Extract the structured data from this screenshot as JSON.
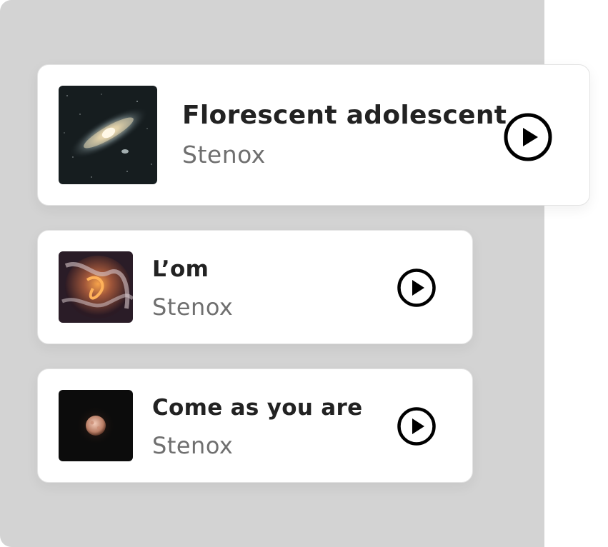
{
  "tracks": [
    {
      "title": "Florescent adolescent",
      "artist": "Stenox",
      "art": "galaxy-artwork",
      "state": "featured"
    },
    {
      "title": "L’om",
      "artist": "Stenox",
      "art": "abstract-flame-artwork"
    },
    {
      "title": "Come as you are",
      "artist": "Stenox",
      "art": "moon-artwork"
    }
  ],
  "icons": {
    "play": "play-circle-icon"
  },
  "colors": {
    "panel_bg": "#d3d3d3",
    "card_bg": "#ffffff",
    "title_text": "#222222",
    "artist_text": "#6f6f6f",
    "icon": "#000000"
  }
}
